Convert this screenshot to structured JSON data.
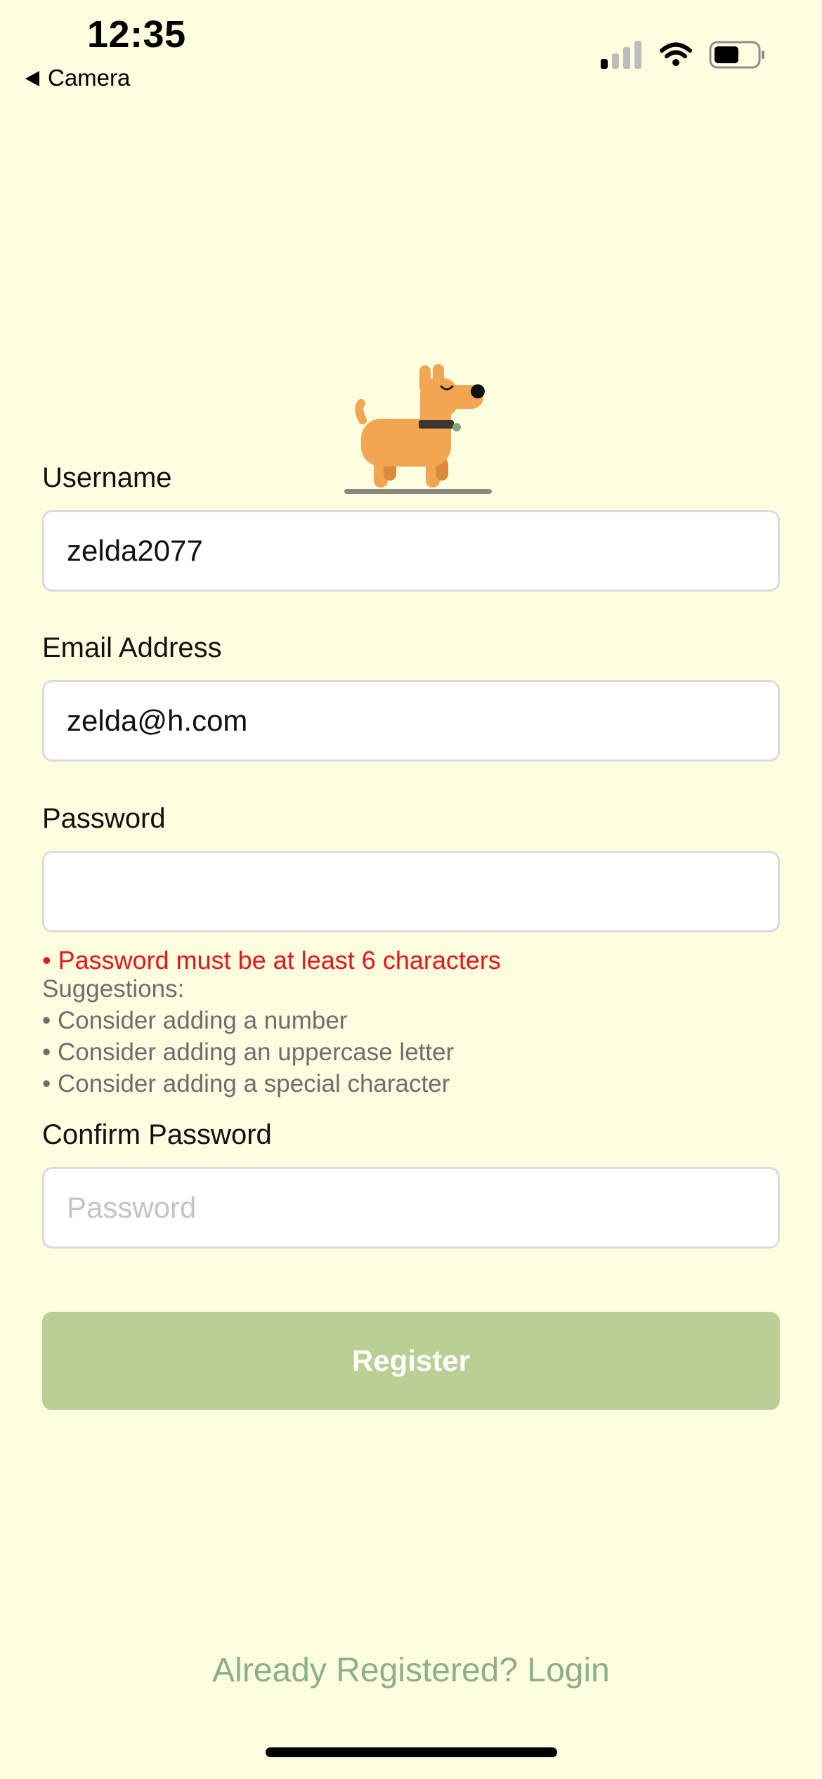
{
  "status_bar": {
    "time": "12:35",
    "back_app": "Camera",
    "icons": [
      "cellular-signal-icon",
      "wifi-icon",
      "battery-icon"
    ]
  },
  "illustration": "dog-illustration",
  "form": {
    "username": {
      "label": "Username",
      "value": "zelda2077"
    },
    "email": {
      "label": "Email Address",
      "value": "zelda@h.com"
    },
    "password": {
      "label": "Password",
      "value": ""
    },
    "password_validation": {
      "error": "• Password must be at least 6 characters",
      "suggestions_title": "Suggestions:",
      "suggestions": [
        "• Consider adding a number",
        "• Consider adding an uppercase letter",
        "• Consider adding a special character"
      ]
    },
    "confirm_password": {
      "label": "Confirm Password",
      "placeholder": "Password"
    },
    "register_label": "Register"
  },
  "login_link": "Already Registered? Login",
  "colors": {
    "background": "#FCFEDF",
    "error": "#E5141B",
    "button": "#BACF94",
    "link": "#8DAE8A",
    "dog": "#F2A652"
  }
}
